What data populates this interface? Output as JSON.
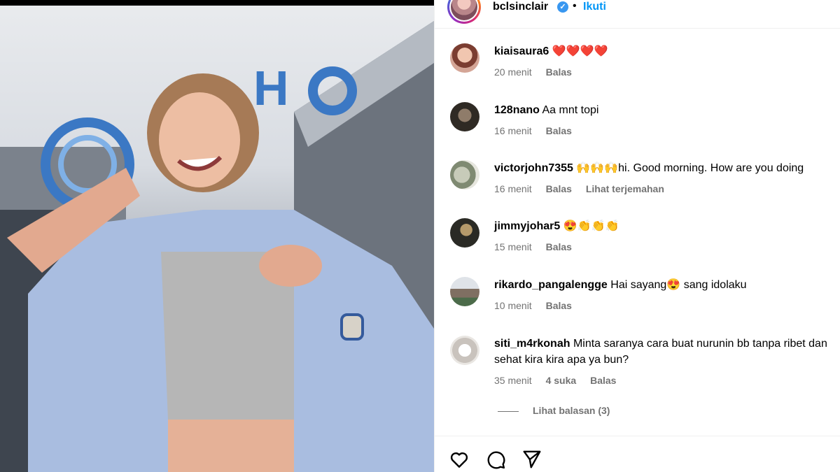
{
  "photo": {
    "alt": ""
  },
  "header": {
    "username": "bclsinclair",
    "verified_icon": "verified-badge-icon",
    "separator": "•",
    "follow_label": "Ikuti"
  },
  "comments": [
    {
      "username": "kiaisaura6",
      "text": "❤️❤️❤️❤️",
      "time": "20 menit",
      "reply": "Balas",
      "likes": "",
      "translate": ""
    },
    {
      "username": "128nano",
      "text": "Aa mnt topi",
      "time": "16 menit",
      "reply": "Balas",
      "likes": "",
      "translate": ""
    },
    {
      "username": "victorjohn7355",
      "text": "🙌🙌🙌hi. Good morning. How are you doing",
      "time": "16 menit",
      "reply": "Balas",
      "likes": "",
      "translate": "Lihat terjemahan"
    },
    {
      "username": "jimmyjohar5",
      "text": "😍👏👏👏",
      "time": "15 menit",
      "reply": "Balas",
      "likes": "",
      "translate": ""
    },
    {
      "username": "rikardo_pangalengge",
      "text": "Hai sayang😍 sang idolaku",
      "time": "10 menit",
      "reply": "Balas",
      "likes": "",
      "translate": ""
    },
    {
      "username": "siti_m4rkonah",
      "text": "Minta saranya cara buat nurunin bb tanpa ribet dan sehat kira kira apa ya bun?",
      "time": "35 menit",
      "reply": "Balas",
      "likes": "4 suka",
      "translate": ""
    }
  ],
  "replies_label": "Lihat balasan (3)",
  "actions": {
    "like_icon": "heart-icon",
    "comment_icon": "comment-bubble-icon",
    "share_icon": "paper-plane-icon"
  },
  "colors": {
    "link_blue": "#0095f6",
    "muted_gray": "#737373",
    "verified_blue": "#3897f0"
  }
}
